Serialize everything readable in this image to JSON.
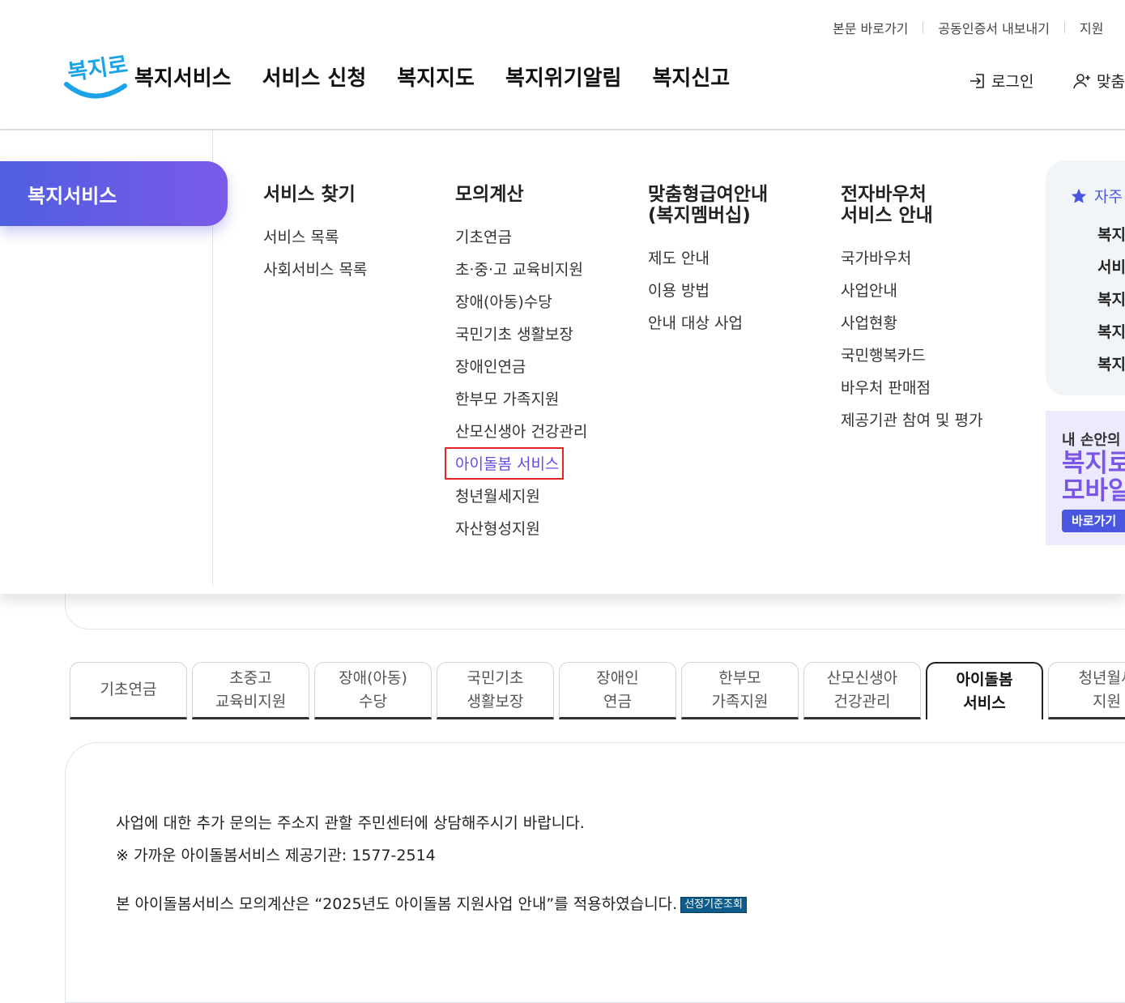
{
  "util": {
    "skip": "본문 바로가기",
    "cert": "공동인증서 내보내기",
    "support": "지원"
  },
  "logo_text": "복지로",
  "gnb": [
    "복지서비스",
    "서비스 신청",
    "복지지도",
    "복지위기알림",
    "복지신고"
  ],
  "header_actions": {
    "login": "로그인",
    "join": "맞춤"
  },
  "mega": {
    "section_title": "복지서비스",
    "columns": [
      {
        "title": "서비스 찾기",
        "items": [
          "서비스 목록",
          "사회서비스 목록"
        ]
      },
      {
        "title": "모의계산",
        "items": [
          "기초연금",
          "초·중·고 교육비지원",
          "장애(아동)수당",
          "국민기초 생활보장",
          "장애인연금",
          "한부모 가족지원",
          "산모신생아 건강관리",
          "아이돌봄 서비스",
          "청년월세지원",
          "자산형성지원"
        ],
        "active_index": 7
      },
      {
        "title_l1": "맞춤형급여안내",
        "title_l2": "(복지멤버십)",
        "items": [
          "제도 안내",
          "이용 방법",
          "안내 대상 사업"
        ]
      },
      {
        "title_l1": "전자바우처",
        "title_l2": "서비스 안내",
        "items": [
          "국가바우처",
          "사업안내",
          "사업현황",
          "국민행복카드",
          "바우처 판매점",
          "제공기관 참여 및 평가"
        ]
      }
    ],
    "favorites": {
      "title": "자주",
      "items": [
        "복지",
        "서비",
        "복지",
        "복지",
        "복지"
      ]
    },
    "banner": {
      "line1": "내 손안의 복",
      "line2": "복지로",
      "line3": "모바일",
      "button": "바로가기"
    }
  },
  "tabs": [
    {
      "l1": "기초연금",
      "l2": ""
    },
    {
      "l1": "초중고",
      "l2": "교육비지원"
    },
    {
      "l1": "장애(아동)",
      "l2": "수당"
    },
    {
      "l1": "국민기초",
      "l2": "생활보장"
    },
    {
      "l1": "장애인",
      "l2": "연금"
    },
    {
      "l1": "한부모",
      "l2": "가족지원"
    },
    {
      "l1": "산모신생아",
      "l2": "건강관리"
    },
    {
      "l1": "아이돌봄",
      "l2": "서비스"
    },
    {
      "l1": "청년월세",
      "l2": "지원"
    }
  ],
  "selected_tab_index": 7,
  "info": {
    "line1": "사업에 대한 추가 문의는 주소지 관할 주민센터에 상담해주시기 바랍니다.",
    "line2": "※ 가까운 아이돌봄서비스 제공기관: 1577-2514",
    "line3": "본 아이돌봄서비스 모의계산은 “2025년도 아이돌봄 지원사업 안내”를 적용하였습니다.",
    "badge": "선정기준조회"
  },
  "colors": {
    "accent": "#6a4ce0",
    "brand_gradient": [
      "#4f5ee0",
      "#7b5ae8"
    ],
    "highlight_box": "#e52525",
    "badge": "#0e5c8c"
  }
}
